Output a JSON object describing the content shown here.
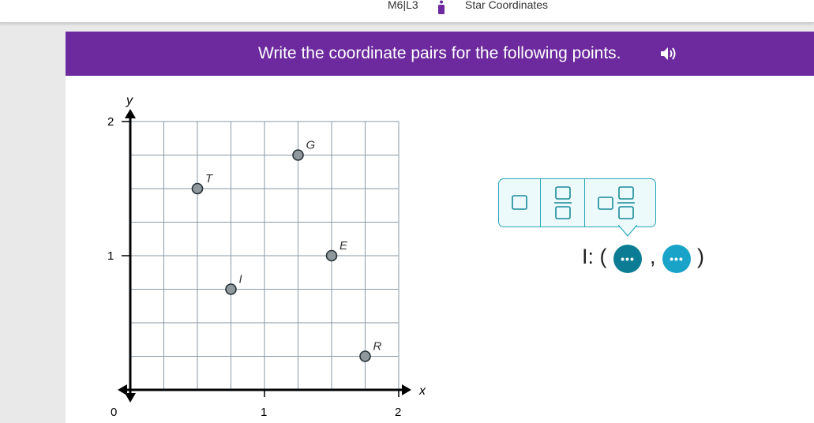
{
  "header": {
    "lesson_id": "M6|L3",
    "lesson_title": "Star Coordinates"
  },
  "banner": {
    "instruction": "Write the coordinate pairs for the following points.",
    "speaker_icon": "speaker-icon",
    "color": "#6c2a9e"
  },
  "chart_data": {
    "type": "scatter",
    "xlabel": "x",
    "ylabel": "y",
    "xlim": [
      0,
      2
    ],
    "ylim": [
      0,
      2
    ],
    "grid_step": 0.25,
    "x_tick_labels": [
      "0",
      "1",
      "2"
    ],
    "y_tick_labels": [
      "1",
      "2"
    ],
    "points": [
      {
        "label": "T",
        "x": 0.5,
        "y": 1.5
      },
      {
        "label": "G",
        "x": 1.25,
        "y": 1.75
      },
      {
        "label": "E",
        "x": 1.5,
        "y": 1.0
      },
      {
        "label": "I",
        "x": 0.75,
        "y": 0.75
      },
      {
        "label": "R",
        "x": 1.75,
        "y": 0.25
      }
    ]
  },
  "palette": {
    "buttons": [
      "whole-number-icon",
      "fraction-icon",
      "mixed-number-icon"
    ],
    "accent": "#29a7b8"
  },
  "answer": {
    "prefix": "I: (",
    "comma": ",",
    "suffix": ")",
    "active_color": "#0b7c93",
    "inactive_color": "#1aa3c8",
    "more_icon": "more-icon"
  }
}
